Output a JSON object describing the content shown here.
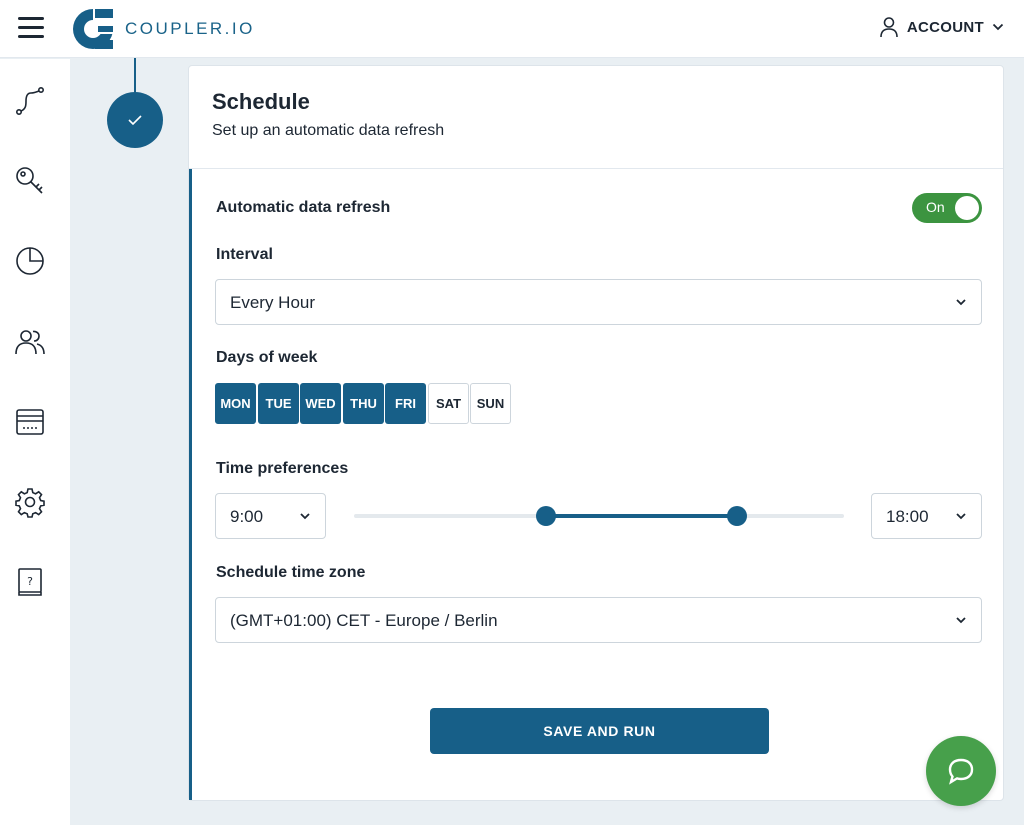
{
  "app": {
    "logo_text": "COUPLER.IO",
    "account_label": "ACCOUNT",
    "brand_color": "#175f88"
  },
  "sidebar": {
    "items": [
      {
        "icon": "route-icon"
      },
      {
        "icon": "key-icon"
      },
      {
        "icon": "pie-chart-icon"
      },
      {
        "icon": "users-icon"
      },
      {
        "icon": "billing-card-icon"
      },
      {
        "icon": "gear-icon"
      },
      {
        "icon": "help-book-icon"
      }
    ]
  },
  "schedule": {
    "title": "Schedule",
    "subtitle": "Set up an automatic data refresh",
    "auto_refresh_label": "Automatic data refresh",
    "auto_refresh_state": "On",
    "interval_label": "Interval",
    "interval_value": "Every Hour",
    "days_label": "Days of week",
    "days": [
      {
        "label": "MON",
        "selected": true
      },
      {
        "label": "TUE",
        "selected": true
      },
      {
        "label": "WED",
        "selected": true
      },
      {
        "label": "THU",
        "selected": true
      },
      {
        "label": "FRI",
        "selected": true
      },
      {
        "label": "SAT",
        "selected": false
      },
      {
        "label": "SUN",
        "selected": false
      }
    ],
    "time_label": "Time preferences",
    "time_start": "9:00",
    "time_end": "18:00",
    "timezone_label": "Schedule time zone",
    "timezone_value": "(GMT+01:00) CET - Europe / Berlin",
    "save_button": "SAVE AND RUN"
  },
  "colors": {
    "accent": "#175f88",
    "toggle_on": "#3c9440",
    "chat": "#47a04b"
  }
}
